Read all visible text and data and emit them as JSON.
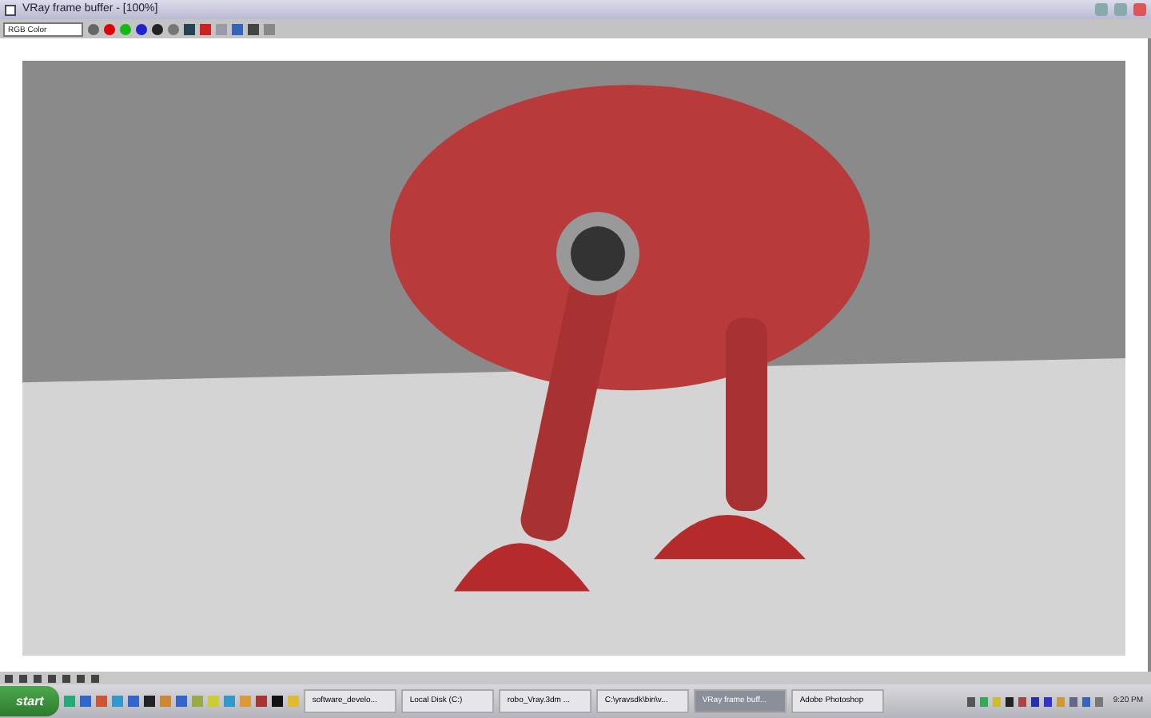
{
  "window": {
    "title": "VRay frame buffer - [100%]"
  },
  "toolbar": {
    "channel": "RGB Color"
  },
  "taskbar": {
    "start": "start",
    "items": [
      {
        "label": "software_develo...",
        "selected": false
      },
      {
        "label": "Local Disk (C:)",
        "selected": false
      },
      {
        "label": "robo_Vray.3dm ...",
        "selected": false
      },
      {
        "label": "C:\\yravsdk\\bin\\v...",
        "selected": false
      },
      {
        "label": "VRay frame buff...",
        "selected": true
      },
      {
        "label": "Adobe Photoshop",
        "selected": false
      }
    ],
    "clock": "9:20 PM"
  }
}
